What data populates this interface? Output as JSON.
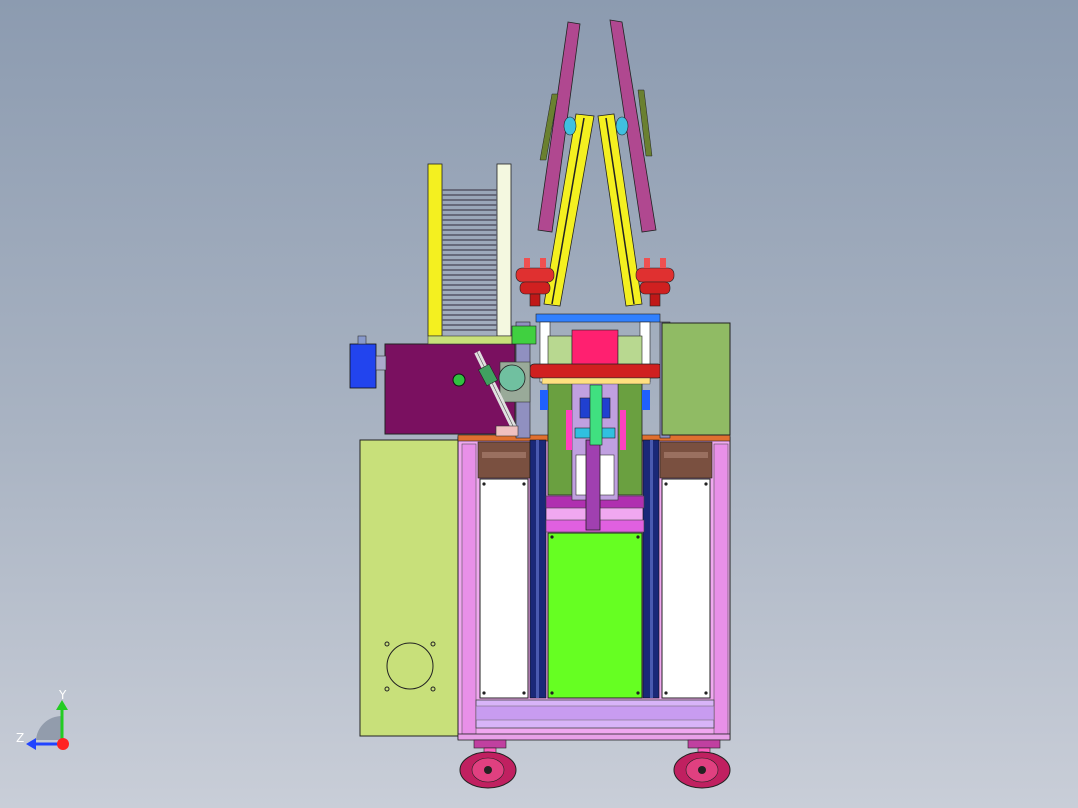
{
  "viewport": {
    "background_top": "#8c9bb0",
    "background_bottom": "#c9ced8"
  },
  "triad": {
    "y_label": "Y",
    "z_label": "Z",
    "y_color": "#22cc22",
    "z_color": "#2244ff",
    "x_color": "#ff2222"
  },
  "model": {
    "icon": "machine-assembly-model",
    "colors": {
      "frame_pink": "#f0a8f0",
      "frame_edge": "#d070d0",
      "panel_lime": "#c8e07a",
      "center_green": "#66ff22",
      "side_green": "#90bb64",
      "purple_box": "#7a1060",
      "blue_box": "#2244ee",
      "yellow_bar": "#f4f020",
      "magenta_arm": "#b04890",
      "red_part": "#d02020",
      "navy_rail": "#1a2878",
      "white_panel": "#ffffff",
      "orange_top": "#e07030",
      "brown_block": "#7a5040",
      "lavender": "#d0a0f0"
    }
  }
}
